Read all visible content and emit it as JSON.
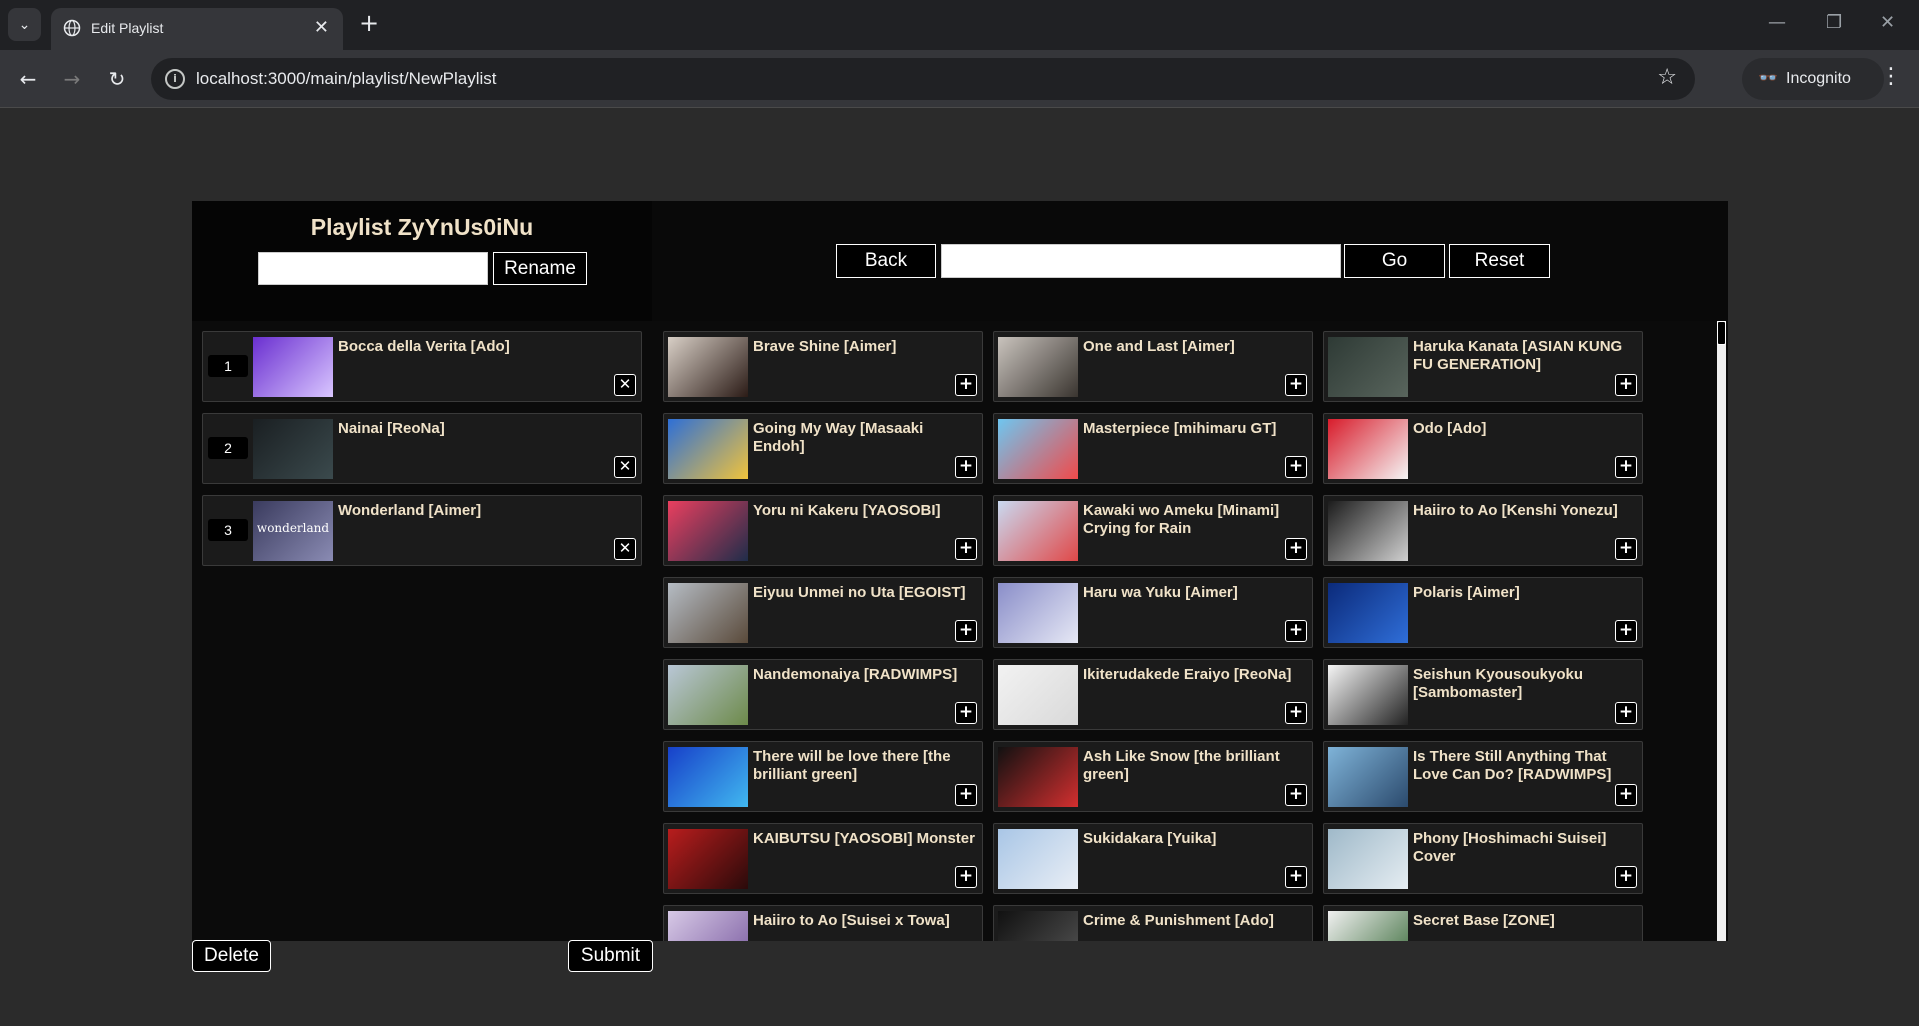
{
  "browser": {
    "tab_title": "Edit Playlist",
    "url": "localhost:3000/main/playlist/NewPlaylist",
    "incognito_label": "Incognito"
  },
  "header": {
    "playlist_title": "Playlist ZyYnUs0iNu",
    "rename_value": "",
    "rename_label": "Rename",
    "back_label": "Back",
    "search_value": "",
    "go_label": "Go",
    "reset_label": "Reset"
  },
  "playlist": [
    {
      "num": "1",
      "title": "Bocca della Verita [Ado]",
      "thumb": [
        "#6a2fd0",
        "#d9c6ff"
      ]
    },
    {
      "num": "2",
      "title": "Nainai [ReoNa]",
      "thumb": [
        "#1a1f22",
        "#3b4a4d"
      ]
    },
    {
      "num": "3",
      "title": "Wonderland [Aimer]",
      "thumb": [
        "#3a3b5e",
        "#8a8bb3"
      ],
      "thumb_text": "wonderland"
    }
  ],
  "songs": [
    {
      "title": "Brave Shine [Aimer]",
      "thumb": [
        "#d8cfc6",
        "#2b1b16"
      ]
    },
    {
      "title": "One and Last [Aimer]",
      "thumb": [
        "#c9c3bd",
        "#3a3530"
      ]
    },
    {
      "title": "Haruka Kanata [ASIAN KUNG FU GENERATION]",
      "thumb": [
        "#2e3a35",
        "#59655d"
      ]
    },
    {
      "title": "Going My Way [Masaaki Endoh]",
      "thumb": [
        "#2e6fd6",
        "#f0c33c"
      ]
    },
    {
      "title": "Masterpiece [mihimaru GT]",
      "thumb": [
        "#6ec6f0",
        "#f04a4a"
      ]
    },
    {
      "title": "Odo [Ado]",
      "thumb": [
        "#d81c2b",
        "#f5f5f5"
      ]
    },
    {
      "title": "Yoru ni Kakeru [YAOSOBI]",
      "thumb": [
        "#ea3f5f",
        "#1f2d4a"
      ]
    },
    {
      "title": "Kawaki wo Ameku [Minami] Crying for Rain",
      "thumb": [
        "#c9d9f0",
        "#e04848"
      ]
    },
    {
      "title": "Haiiro to Ao [Kenshi Yonezu]",
      "thumb": [
        "#1c1c1c",
        "#d0d0d0"
      ]
    },
    {
      "title": "Eiyuu Unmei no Uta [EGOIST]",
      "thumb": [
        "#b5bcc4",
        "#5a4a3a"
      ]
    },
    {
      "title": "Haru wa Yuku [Aimer]",
      "thumb": [
        "#8a8ec9",
        "#e6e8f5"
      ]
    },
    {
      "title": "Polaris [Aimer]",
      "thumb": [
        "#0b2a7a",
        "#2f6ed8"
      ]
    },
    {
      "title": "Nandemonaiya [RADWIMPS]",
      "thumb": [
        "#b9c7d6",
        "#6d8a4a"
      ]
    },
    {
      "title": "Ikiterudakede Eraiyo [ReoNa]",
      "thumb": [
        "#f2f2f2",
        "#d9d9d9"
      ]
    },
    {
      "title": "Seishun Kyousoukyoku [Sambomaster]",
      "thumb": [
        "#f5f5f5",
        "#222222"
      ]
    },
    {
      "title": "There will be love there [the brilliant green]",
      "thumb": [
        "#1740c9",
        "#41b8f0"
      ]
    },
    {
      "title": "Ash Like Snow [the brilliant green]",
      "thumb": [
        "#111111",
        "#d32f2f"
      ]
    },
    {
      "title": "Is There Still Anything That Love Can Do?  [RADWIMPS]",
      "thumb": [
        "#7fb3d8",
        "#2b4a6d"
      ]
    },
    {
      "title": "KAIBUTSU [YAOSOBI] Monster",
      "thumb": [
        "#b81d1d",
        "#2a0a0a"
      ]
    },
    {
      "title": "Sukidakara [Yuika]",
      "thumb": [
        "#a9c6e6",
        "#e9eef5"
      ]
    },
    {
      "title": "Phony [Hoshimachi Suisei] Cover",
      "thumb": [
        "#9fb9c9",
        "#e5edf2"
      ]
    },
    {
      "title": "Haiiro to Ao [Suisei x Towa]",
      "thumb": [
        "#d7c9e6",
        "#7a5ba0"
      ]
    },
    {
      "title": "Crime & Punishment [Ado]",
      "thumb": [
        "#111111",
        "#555555"
      ]
    },
    {
      "title": "Secret Base [ZONE]",
      "thumb": [
        "#f0f0f0",
        "#3a6b3a"
      ]
    }
  ],
  "footer": {
    "delete_label": "Delete",
    "submit_label": "Submit"
  }
}
